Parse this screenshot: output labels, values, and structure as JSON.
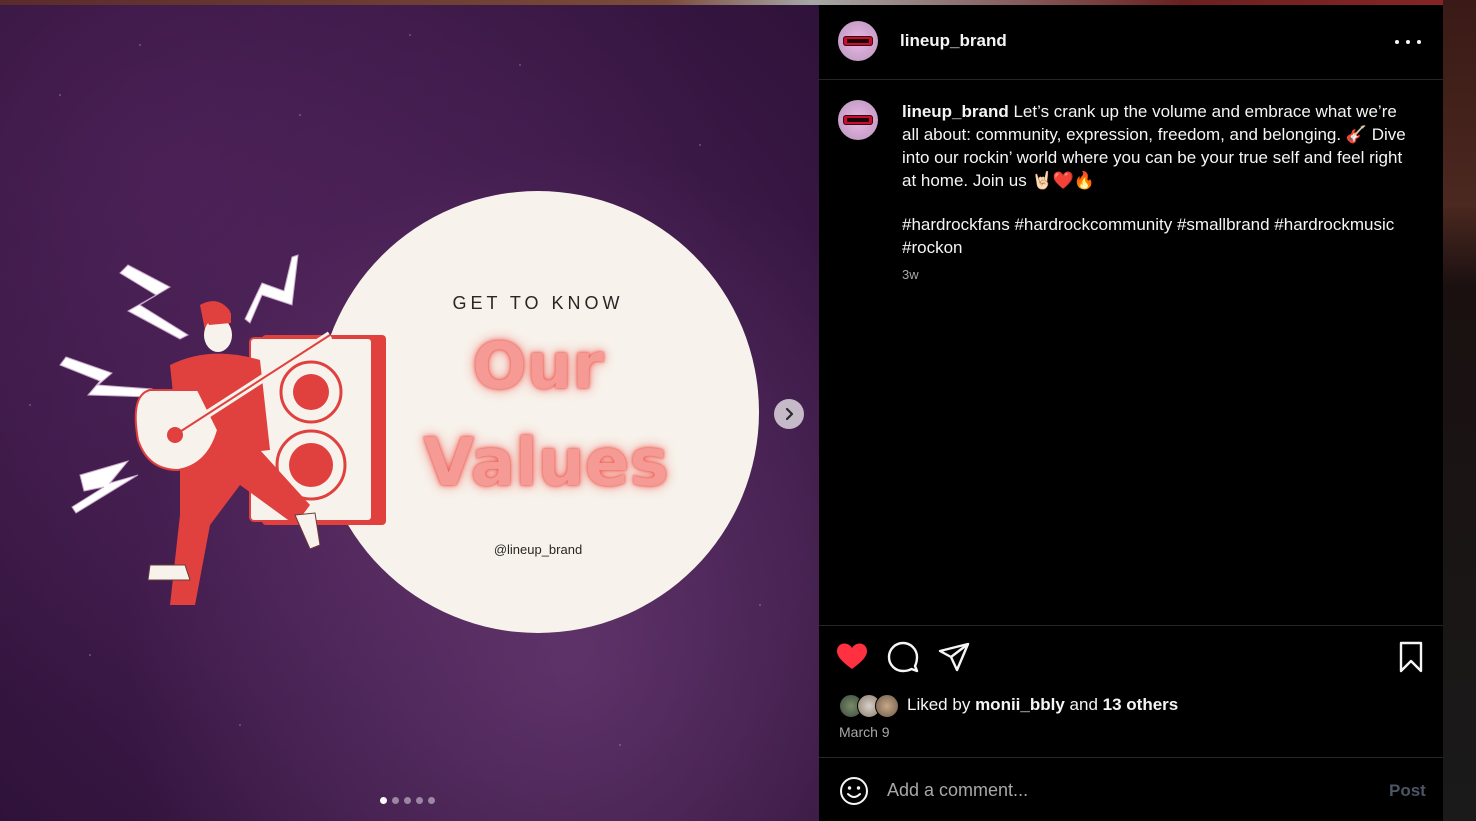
{
  "post": {
    "username": "lineup_brand",
    "caption_username": "lineup_brand",
    "caption_text": "Let’s crank up the volume and embrace what we’re all about: community, expression, freedom, and belonging. 🎸 Dive into our rockin’ world where you can be your true self and feel right at home. Join us 🤘🏻❤️🔥",
    "hashtags": "#hardrockfans #hardrockcommunity #smallbrand #hardrockmusic #rockon",
    "time_ago": "3w",
    "liked_by_prefix": "Liked by",
    "liked_by_user": "monii_bbly",
    "liked_by_and": "and",
    "liked_by_others": "13 others",
    "date": "March 9"
  },
  "media": {
    "eyebrow": "GET TO KNOW",
    "headline_line1": "Our",
    "headline_line2": "Values",
    "handle": "@lineup_brand",
    "slide_count": 5,
    "active_slide": 1
  },
  "comment": {
    "placeholder": "Add a comment...",
    "post_label": "Post"
  },
  "icons": {
    "more": "more-horizontal-icon",
    "like": "heart-filled-icon",
    "comment": "comment-bubble-icon",
    "share": "paper-plane-icon",
    "save": "bookmark-icon",
    "emoji": "smiley-icon",
    "next": "chevron-right-icon"
  },
  "colors": {
    "like": "#ff3040",
    "accent_red": "#e0413f",
    "headline": "#f59a94",
    "panel_bg": "#000000",
    "media_bg": "#3b1947"
  }
}
